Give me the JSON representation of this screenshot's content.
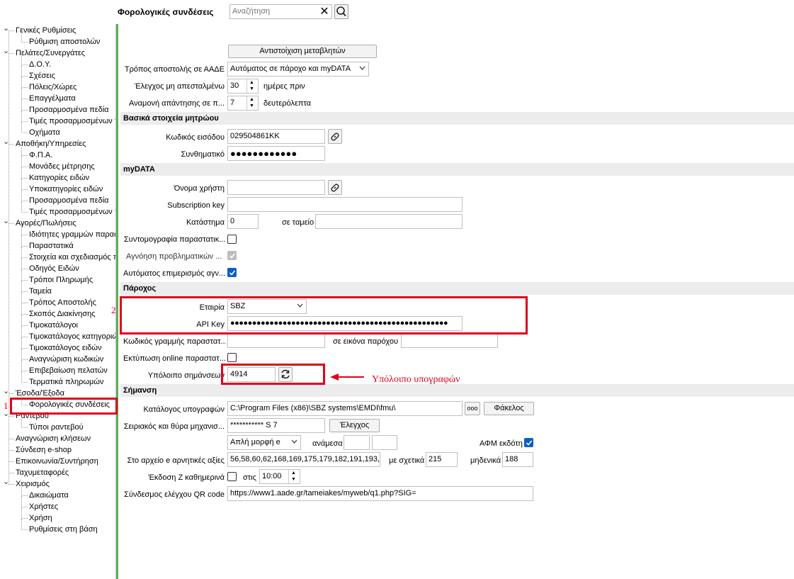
{
  "header": {
    "title": "Φορολογικές συνδέσεις",
    "search_placeholder": "Αναζήτηση"
  },
  "sidebar": {
    "items": [
      {
        "label": "Γενικές Ρυθμίσεις",
        "level": 0,
        "expanded": true
      },
      {
        "label": "Ρύθμιση αποστολών",
        "level": 1
      },
      {
        "label": "Πελάτες/Συνεργάτες",
        "level": 0,
        "expanded": true
      },
      {
        "label": "Δ.Ο.Υ.",
        "level": 1
      },
      {
        "label": "Σχέσεις",
        "level": 1
      },
      {
        "label": "Πόλεις/Χώρες",
        "level": 1
      },
      {
        "label": "Επαγγέλματα",
        "level": 1
      },
      {
        "label": "Προσαρμοσμένα πεδία",
        "level": 1
      },
      {
        "label": "Τιμές προσαρμοσμένων π",
        "level": 1
      },
      {
        "label": "Οχήματα",
        "level": 1
      },
      {
        "label": "Αποθήκη/Υπηρεσίες",
        "level": 0,
        "expanded": true
      },
      {
        "label": "Φ.Π.Α.",
        "level": 1
      },
      {
        "label": "Μονάδες μέτρησης",
        "level": 1
      },
      {
        "label": "Κατηγορίες ειδών",
        "level": 1
      },
      {
        "label": "Υποκατηγορίες ειδών",
        "level": 1
      },
      {
        "label": "Προσαρμοσμένα πεδία",
        "level": 1
      },
      {
        "label": "Τιμές προσαρμοσμένων π",
        "level": 1
      },
      {
        "label": "Αγορές/Πωλήσεις",
        "level": 0,
        "expanded": true
      },
      {
        "label": "Ιδιότητες γραμμών παρασ",
        "level": 1
      },
      {
        "label": "Παραστατικά",
        "level": 1
      },
      {
        "label": "Στοιχεία και σχεδιασμός π",
        "level": 1
      },
      {
        "label": "Οδηγός Ειδών",
        "level": 1
      },
      {
        "label": "Τρόποι Πληρωμής",
        "level": 1
      },
      {
        "label": "Ταμεία",
        "level": 1
      },
      {
        "label": "Τρόπος Αποστολής",
        "level": 1
      },
      {
        "label": "Σκοπός Διακίνησης",
        "level": 1
      },
      {
        "label": "Τιμοκατάλογοι",
        "level": 1
      },
      {
        "label": "Τιμοκατάλογος κατηγοριώ",
        "level": 1
      },
      {
        "label": "Τιμοκατάλογος ειδών",
        "level": 1
      },
      {
        "label": "Αναγνώριση κωδικών",
        "level": 1
      },
      {
        "label": "Επιβεβαίωση πελατών",
        "level": 1
      },
      {
        "label": "Τερματικά πληρωμών",
        "level": 1
      },
      {
        "label": "Έσοδα/Έξοδα",
        "level": 0,
        "expanded": true
      },
      {
        "label": "Φορολογικές συνδέσεις",
        "level": 1,
        "selected": true
      },
      {
        "label": "Ραντεβού",
        "level": 0,
        "expanded": true
      },
      {
        "label": "Τύποι ραντεβού",
        "level": 1
      },
      {
        "label": "Αναγνώριση κλήσεων",
        "level": 0
      },
      {
        "label": "Σύνδεση e-shop",
        "level": 0
      },
      {
        "label": "Επικοινωνία/Συντήρηση",
        "level": 0
      },
      {
        "label": "Ταχυμεταφορές",
        "level": 0
      },
      {
        "label": "Χειρισμός",
        "level": 0,
        "expanded": true
      },
      {
        "label": "Δικαιώματα",
        "level": 1
      },
      {
        "label": "Χρήστες",
        "level": 1
      },
      {
        "label": "Χρήση",
        "level": 1
      },
      {
        "label": "Ρυθμίσεις στη βάση",
        "level": 1
      }
    ]
  },
  "general": {
    "map_button": "Αντιστοίχιση μεταβλητών",
    "send_mode_label": "Τρόπος αποστολής σε ΑΑΔΕ",
    "send_mode_value": "Αυτόματος σε πάροχο και myDATA",
    "check_unsent_label": "Έλεγχος μη απεσταλμένω",
    "check_unsent_value": "30",
    "check_unsent_unit": "ημέρες πριν",
    "wait_label": "Αναμονή απάντησης σε π...",
    "wait_value": "7",
    "wait_unit": "δευτερόλεπτα"
  },
  "registry": {
    "header": "Βασικά στοιχεία μητρώου",
    "code_label": "Κωδικός εισόδου",
    "code_value": "029504861KK",
    "password_label": "Συνθηματικό",
    "password_value": "●●●●●●●●●●●●"
  },
  "mydata": {
    "header": "myDATA",
    "username_label": "Όνομα χρήστη",
    "username_value": "",
    "subkey_label": "Subscription key",
    "subkey_value": "",
    "store_label": "Κατάστημα",
    "store_value": "0",
    "register_label": "σε ταμείο",
    "register_value": "",
    "abbrev_label": "Συντομογραφία παραστατικ...",
    "ignore_label": "Αγνόηση προβληματικών ...",
    "auto_label": "Αυτόματος επιμερισμός αγν..."
  },
  "provider": {
    "header": "Πάροχος",
    "company_label": "Εταιρία",
    "company_value": "SBZ",
    "apikey_label": "API Key",
    "apikey_value": "●●●●●●●●●●●●●●●●●●●●●●●●●●●●●●●●●●●●●●●●●●●●●●●●●●",
    "line_code_label": "Κωδικός γραμμής παραστατ...",
    "line_code_value": "",
    "provider_image_label": "σε εικόνα παρόχου",
    "provider_image_value": "",
    "print_online_label": "Εκτύπωση online παραστατ...",
    "balance_label": "Υπόλοιπο σημάνσεων",
    "balance_value": "4914"
  },
  "signing": {
    "header": "Σήμανση",
    "dir_label": "Κατάλογος υπογραφών",
    "dir_value": "C:\\Program Files (x86)\\SBZ systems\\EMDI\\fmu\\",
    "dir_browse": "ooo",
    "folder_button": "Φάκελος",
    "serial_label": "Σειριακός και θύρα μηχανισ...",
    "serial_value": "*********** S 7",
    "check_button": "Έλεγχος",
    "format_value": "Απλή μορφή e",
    "between_label": "ανάμεσα",
    "between_a": "",
    "between_b": "",
    "afm_label": "ΑΦΜ εκδότη",
    "negative_label": "Στο αρχείο e αρνητικές αξίες",
    "negative_value": "56,58,60,62,168,169,175,179,182,191,193,1",
    "relative_label": "με σχετικά",
    "relative_value": "215",
    "zero_label": "μηδενικά",
    "zero_value": "188",
    "z_label": "Έκδοση Ζ καθημερινά",
    "z_at_label": "στις",
    "z_time": "10:00",
    "qr_label": "Σύνδεσμος ελέγχου QR code",
    "qr_value": "https://www1.aade.gr/tameiakes/myweb/q1.php?SIG="
  },
  "annotations": {
    "marker_1": "1",
    "marker_2": "2",
    "arrow_note": "Υπόλοιπο υπογραφών",
    "color": "#e0001b"
  },
  "colors": {
    "accent": "#0a5fc6",
    "section_bg": "#ececec",
    "sidebar_accent": "#5ab05a"
  }
}
